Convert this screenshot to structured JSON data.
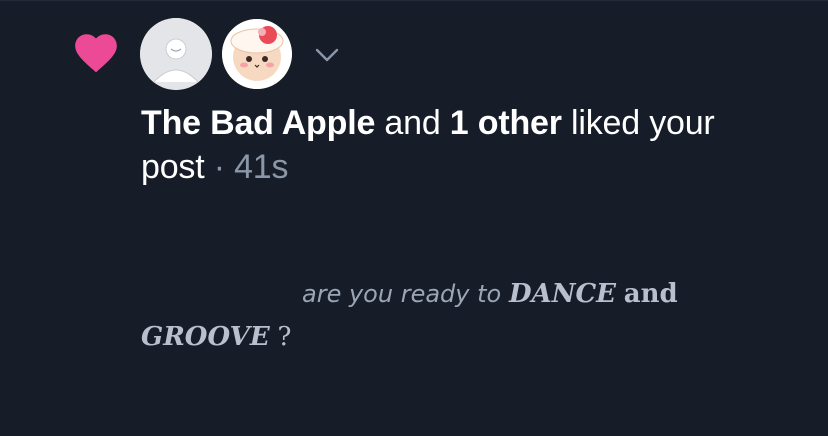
{
  "colors": {
    "background": "#161d28",
    "heart": "#ec4a97",
    "text": "#ffffff",
    "muted": "#8b97a8"
  },
  "notification": {
    "actor": "The Bad Apple",
    "connector": "and",
    "others": "1 other",
    "action": "liked your",
    "action_cont": "post",
    "separator": "·",
    "time": "41s"
  },
  "post": {
    "part1": "are you ready to",
    "part2": "DANCE",
    "part3": "and",
    "part4": "GROOVE",
    "part5": "?"
  },
  "icons": {
    "like": "heart-icon",
    "expand": "chevron-down-icon"
  }
}
